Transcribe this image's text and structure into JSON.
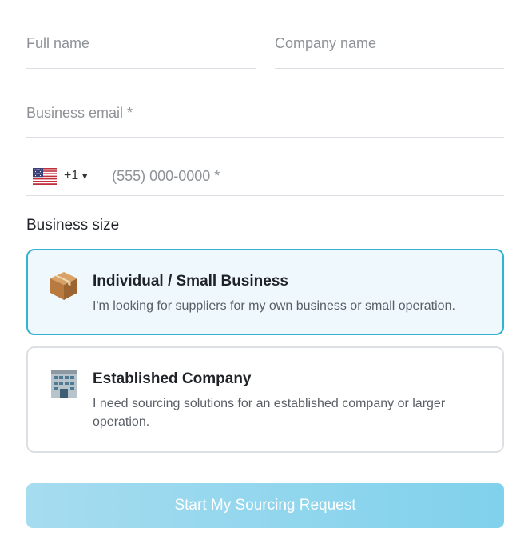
{
  "form": {
    "full_name": {
      "value": "",
      "placeholder": "Full name"
    },
    "company_name": {
      "value": "",
      "placeholder": "Company name"
    },
    "business_email": {
      "value": "",
      "placeholder": "Business email *"
    },
    "phone": {
      "country_flag": "us-flag-icon",
      "country_code": "+1",
      "dropdown_arrow": "▼",
      "value": "",
      "placeholder": "(555) 000-0000 *"
    }
  },
  "business_size": {
    "label": "Business size",
    "selected": "individual",
    "options": [
      {
        "id": "individual",
        "icon": "package-icon",
        "title": "Individual / Small Business",
        "description": "I'm looking for suppliers for my own business or small operation."
      },
      {
        "id": "established",
        "icon": "office-building-icon",
        "title": "Established Company",
        "description": "I need sourcing solutions for an established company or larger operation."
      }
    ]
  },
  "submit": {
    "label": "Start My Sourcing Request"
  },
  "colors": {
    "selected_border": "#33b3cf",
    "selected_bg": "#eef8fd",
    "button_gradient_start": "#a6dcef",
    "button_gradient_end": "#80d1ec"
  }
}
